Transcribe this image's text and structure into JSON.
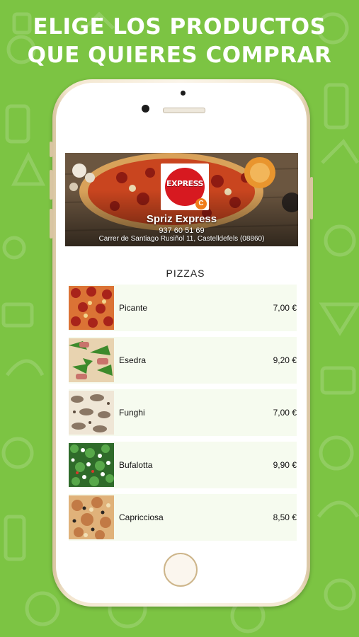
{
  "headline": {
    "line1": "ELIGE LOS PRODUCTOS",
    "line2": "QUE QUIERES COMPRAR"
  },
  "store": {
    "logo_text": "EXPRESS",
    "logo_badge": "C",
    "name": "Spriz Express",
    "phone": "937 60 51 69",
    "address": "Carrer de Santiago Rusiñol 11, Castelldefels (08860)"
  },
  "section": {
    "title": "PIZZAS"
  },
  "products": [
    {
      "name": "Picante",
      "price": "7,00 €",
      "image": "pizza-picante-image"
    },
    {
      "name": "Esedra",
      "price": "9,20 €",
      "image": "pizza-esedra-image"
    },
    {
      "name": "Funghi",
      "price": "7,00 €",
      "image": "pizza-funghi-image"
    },
    {
      "name": "Bufalotta",
      "price": "9,90 €",
      "image": "pizza-bufalotta-image"
    },
    {
      "name": "Capricciosa",
      "price": "8,50 €",
      "image": "pizza-capricciosa-image"
    }
  ],
  "colors": {
    "background": "#7cc443",
    "row_background": "#f6fbef",
    "logo_red": "#d71920",
    "logo_badge": "#f07c1a"
  }
}
